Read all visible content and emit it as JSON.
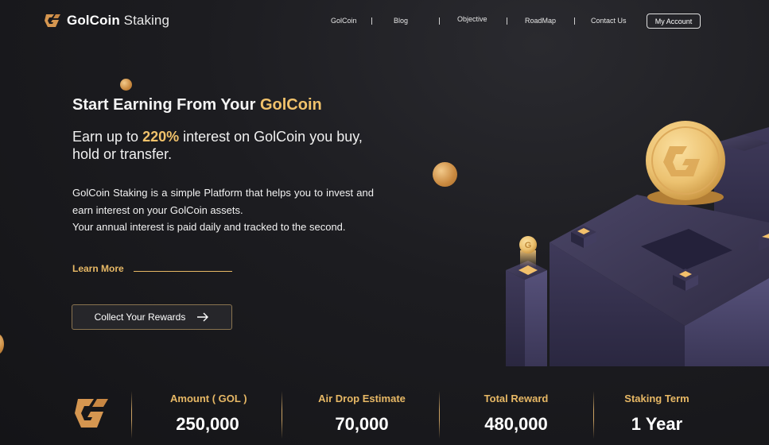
{
  "brand": {
    "name_bold": "GolCoin",
    "name_light": " Staking"
  },
  "nav": {
    "links": [
      "GolCoin",
      "Blog",
      "Objective",
      "RoadMap",
      "Contact Us"
    ],
    "account": "My Account"
  },
  "hero": {
    "title_prefix": "Start Earning From Your ",
    "title_gold": "GolCoin",
    "sub_prefix": "Earn up to ",
    "sub_gold": "220%",
    "sub_suffix": " interest on GolCoin you buy, hold or transfer.",
    "desc_1": "GolCoin Staking is a simple Platform that helps you to invest and earn interest on your GolCoin assets.",
    "desc_2": "Your annual interest is paid daily and tracked to the second.",
    "learn_more": "Learn More",
    "cta": "Collect Your Rewards"
  },
  "stats": [
    {
      "label": "Amount ( GOL )",
      "value": "250,000"
    },
    {
      "label": "Air Drop Estimate",
      "value": "70,000"
    },
    {
      "label": "Total Reward",
      "value": "480,000"
    },
    {
      "label": "Staking Term",
      "value": "1 Year"
    }
  ],
  "colors": {
    "gold": "#f1c26b",
    "accent": "#e7b865",
    "background": "#1c1c20"
  },
  "icons": [
    "golcoin-logo-icon",
    "arrow-right-icon",
    "coin-icon"
  ]
}
